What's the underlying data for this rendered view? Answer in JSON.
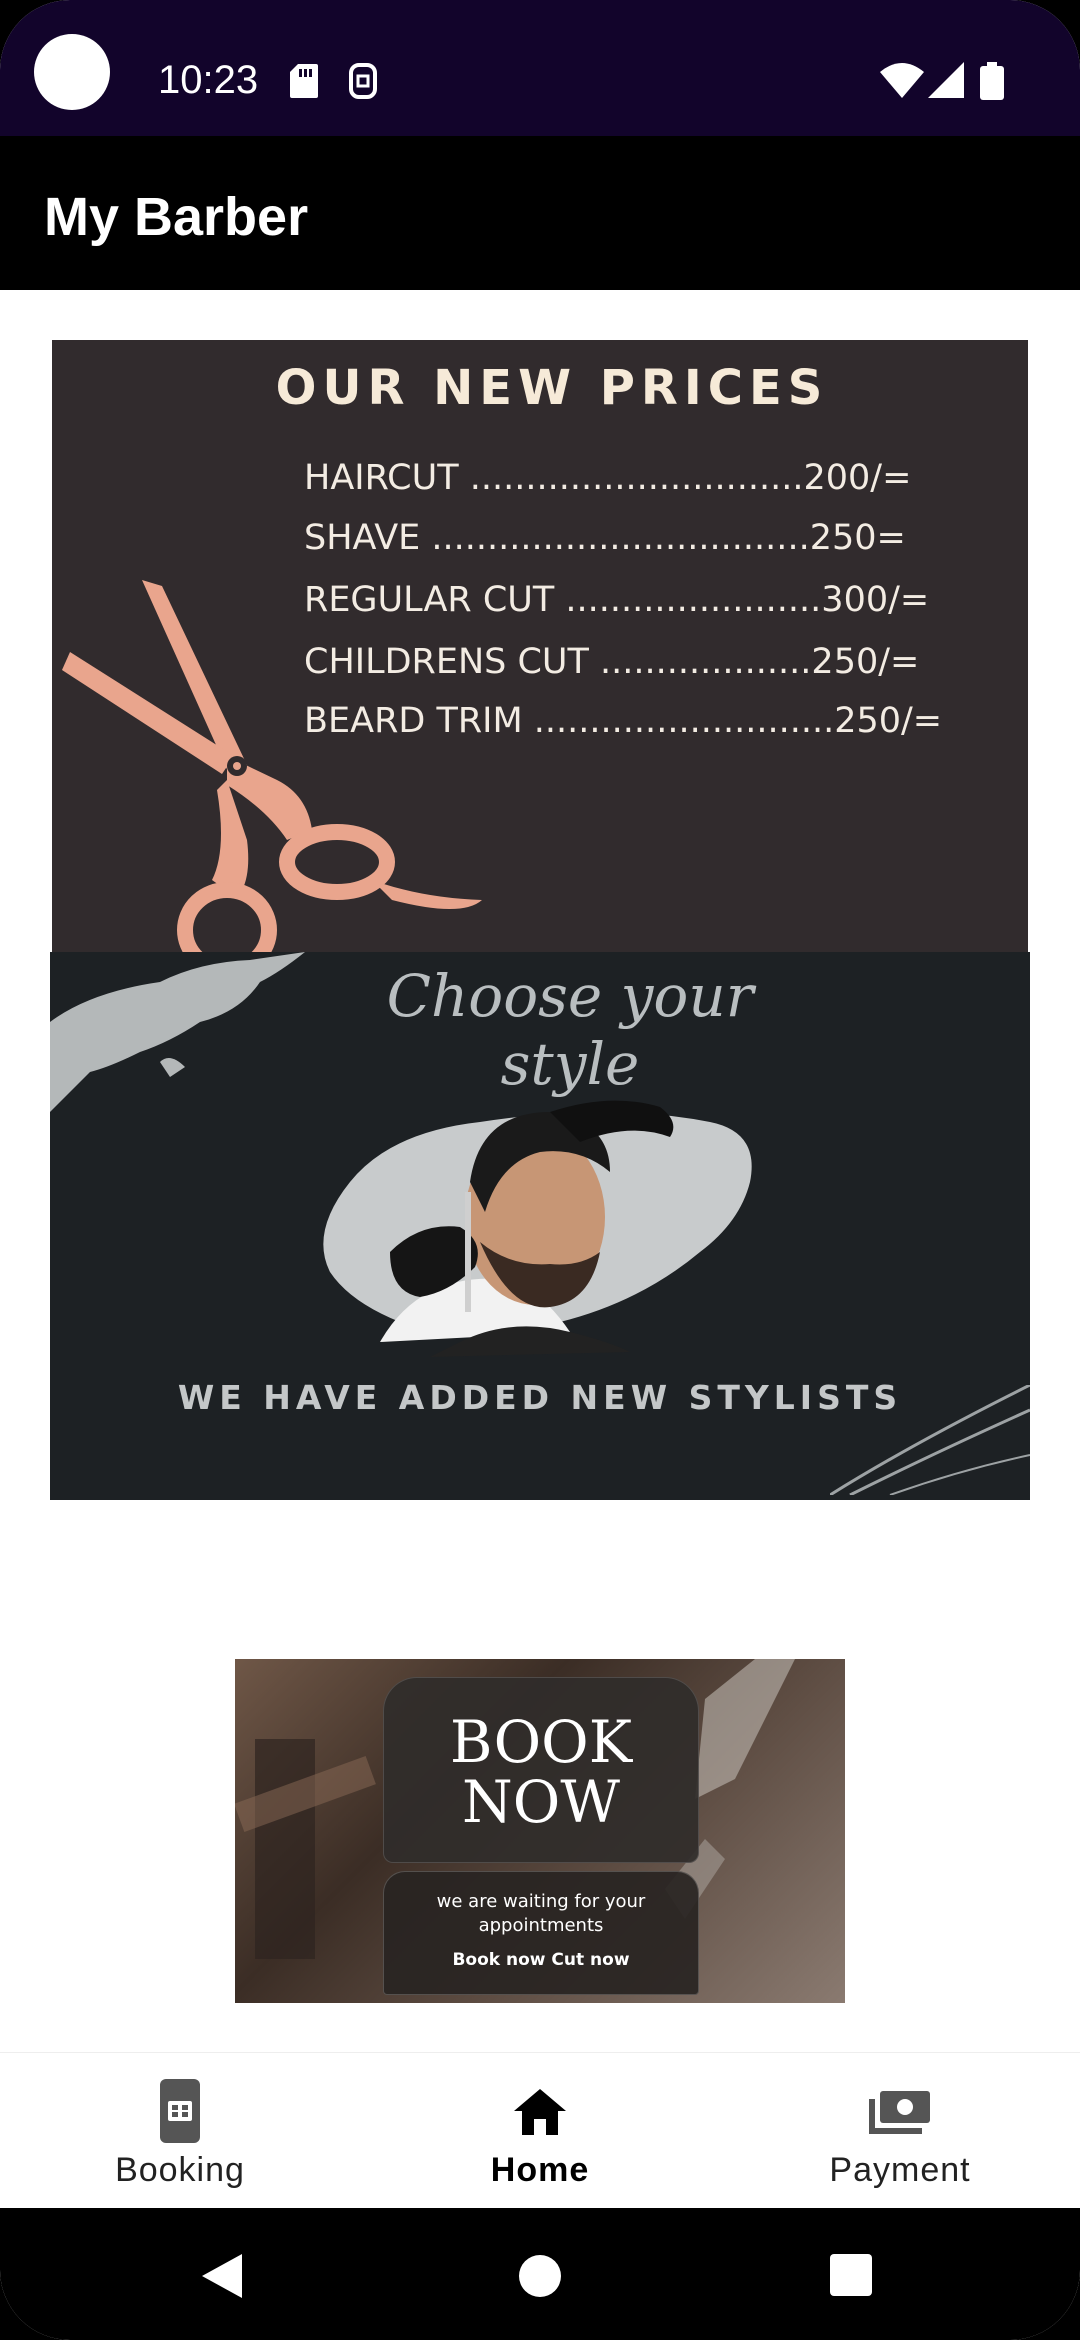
{
  "status_bar": {
    "time": "10:23",
    "icons": [
      "camera-cutout",
      "sd-card-icon",
      "sim-icon",
      "wifi-icon",
      "signal-icon",
      "battery-icon"
    ]
  },
  "app_bar": {
    "title": "My Barber"
  },
  "prices_banner": {
    "title": "OUR NEW PRICES",
    "rows": [
      "HAIRCUT ..............................200/=",
      "SHAVE ..................................250=",
      "REGULAR CUT .......................300/=",
      "CHILDRENS CUT ...................250/=",
      "BEARD TRIM ...........................250/="
    ],
    "accent_color": "#e9a58d",
    "background_color": "#312b2d"
  },
  "stylists_banner": {
    "script_title": "Choose your style",
    "caption": "WE HAVE ADDED NEW STYLISTS",
    "background_color": "#1d2124"
  },
  "book_banner": {
    "title_line1": "BOOK",
    "title_line2": "NOW",
    "subtitle": "we are waiting for your appointments",
    "cta": "Book now Cut now"
  },
  "bottom_nav": {
    "items": [
      {
        "label": "Booking",
        "icon": "phone-booking-icon",
        "active": false
      },
      {
        "label": "Home",
        "icon": "home-icon",
        "active": true
      },
      {
        "label": "Payment",
        "icon": "payment-icon",
        "active": false
      }
    ]
  },
  "system_nav": {
    "buttons": [
      "back-icon",
      "home-circle-icon",
      "recents-icon"
    ]
  }
}
